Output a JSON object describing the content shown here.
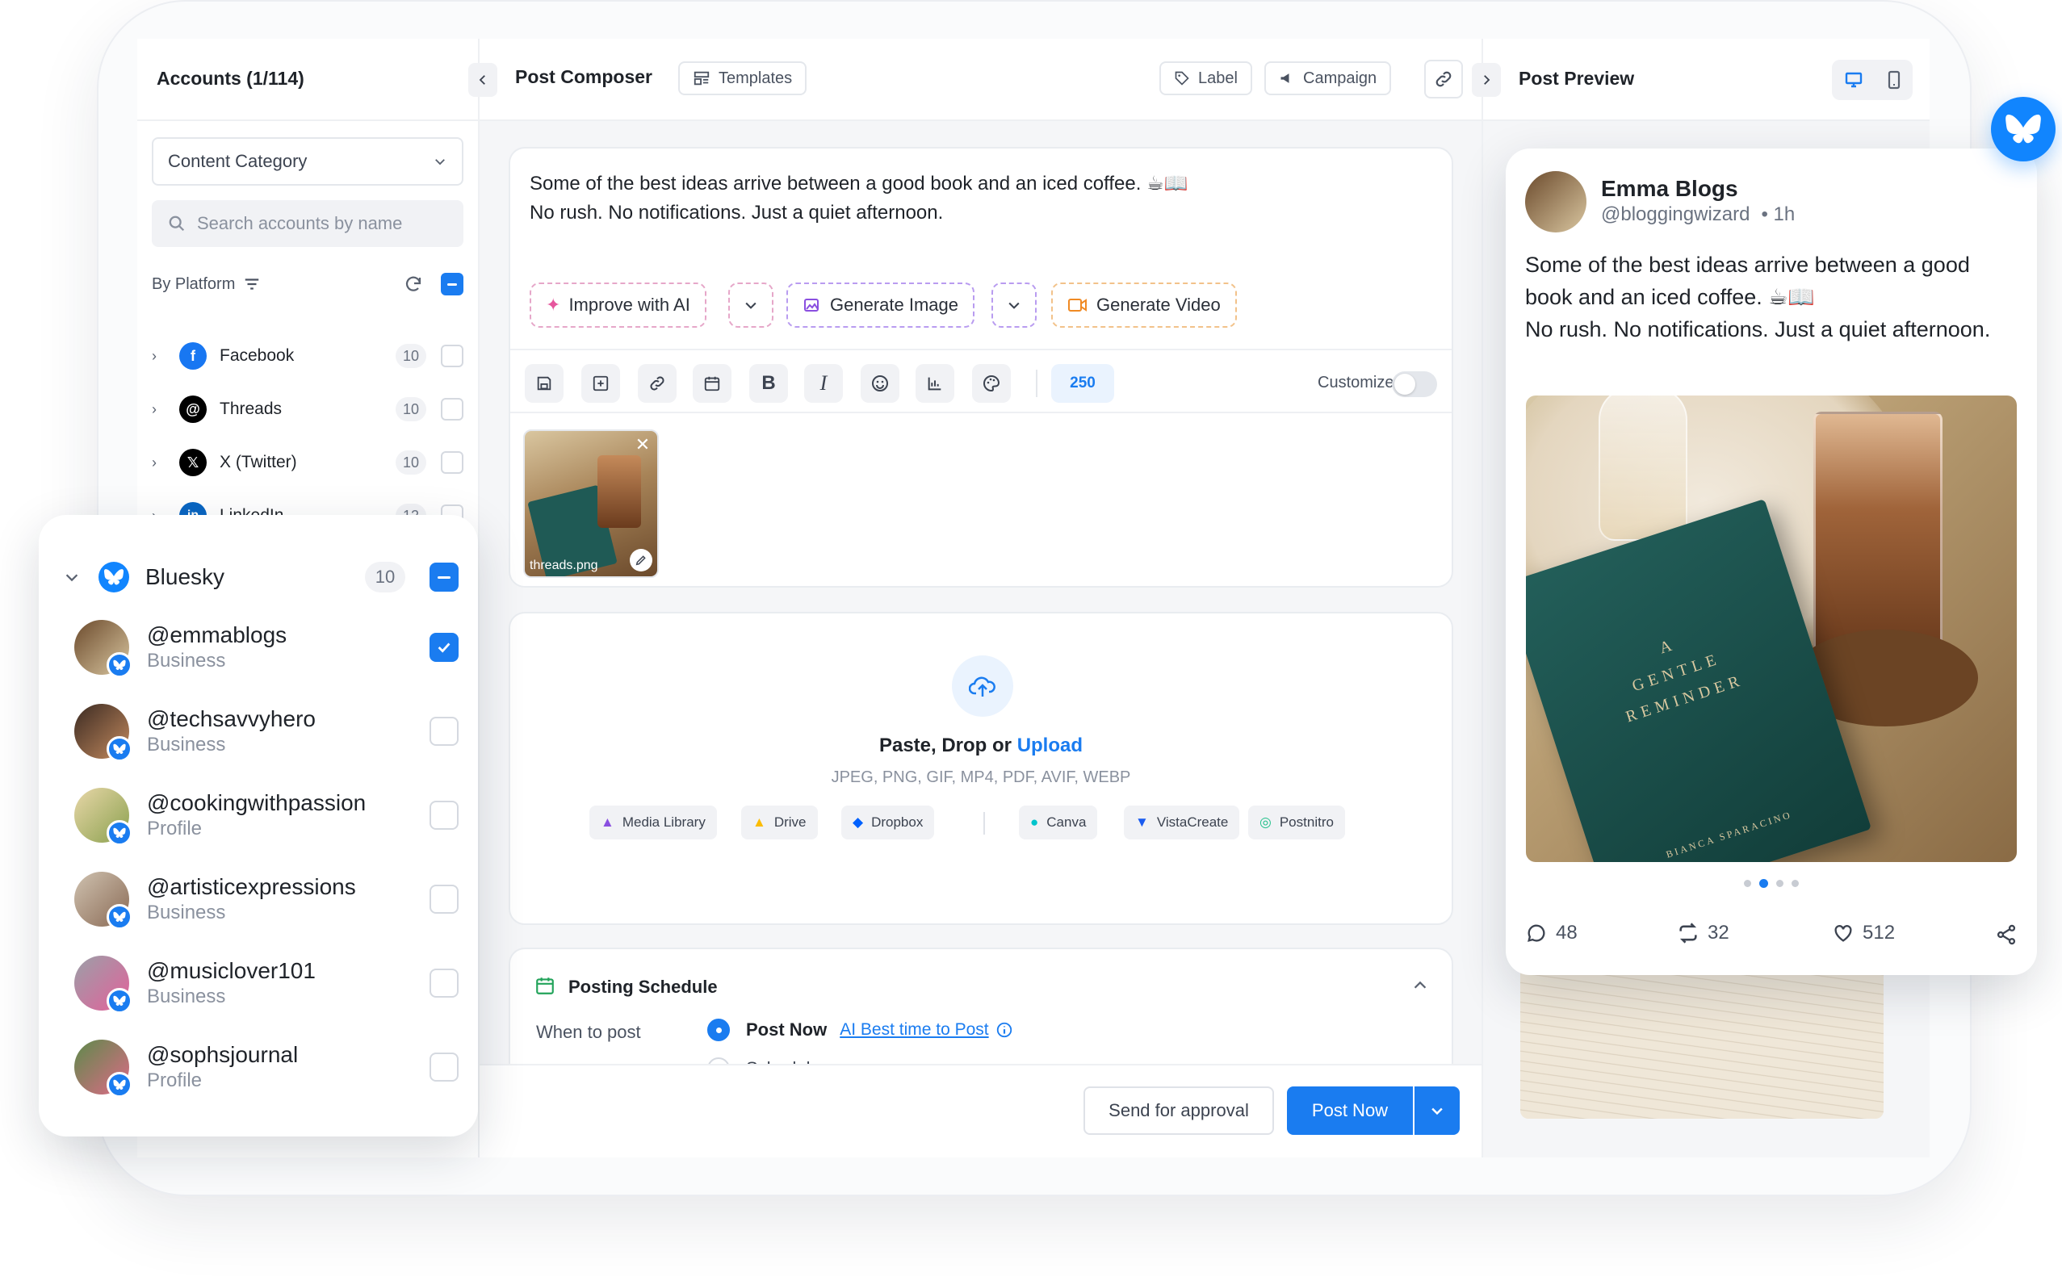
{
  "accounts": {
    "title": "Accounts (1/114)",
    "category_select": "Content Category",
    "search_placeholder": "Search accounts by name",
    "by_platform": "By Platform",
    "platforms": [
      {
        "name": "Facebook",
        "count": "10",
        "color": "#1877f2"
      },
      {
        "name": "Threads",
        "count": "10",
        "color": "#000000"
      },
      {
        "name": "X (Twitter)",
        "count": "10",
        "color": "#000000"
      },
      {
        "name": "LinkedIn",
        "count": "12",
        "color": "#0a66c2"
      }
    ]
  },
  "bluesky": {
    "name": "Bluesky",
    "count": "10",
    "users": [
      {
        "handle": "@emmablogs",
        "type": "Business",
        "checked": true
      },
      {
        "handle": "@techsavvyhero",
        "type": "Business",
        "checked": false
      },
      {
        "handle": "@cookingwithpassion",
        "type": "Profile",
        "checked": false
      },
      {
        "handle": "@artisticexpressions",
        "type": "Business",
        "checked": false
      },
      {
        "handle": "@musiclover101",
        "type": "Business",
        "checked": false
      },
      {
        "handle": "@sophsjournal",
        "type": "Profile",
        "checked": false
      }
    ]
  },
  "composer": {
    "title": "Post Composer",
    "templates": "Templates",
    "label": "Label",
    "campaign": "Campaign",
    "post_line1": "Some of the best ideas arrive between a good book and an iced coffee. ☕📖",
    "post_line2": "No rush. No notifications. Just a quiet afternoon.",
    "improve_ai": "Improve with AI",
    "generate_image": "Generate Image",
    "generate_video": "Generate Video",
    "char_count": "250",
    "customize": "Customize",
    "attachment_name": "threads.png",
    "upload_prefix": "Paste, Drop or ",
    "upload_link": "Upload",
    "formats": "JPEG, PNG, GIF, MP4, PDF, AVIF, WEBP",
    "sources": [
      "Media Library",
      "Drive",
      "Dropbox",
      "Canva",
      "VistaCreate",
      "Postnitro"
    ],
    "schedule_title": "Posting Schedule",
    "when_label": "When to post",
    "post_now_opt": "Post Now",
    "ai_best": "AI Best time to Post",
    "schedule_opt": "Schedule",
    "send_approval": "Send for approval",
    "post_now_btn": "Post Now"
  },
  "preview": {
    "title": "Post Preview",
    "author": "Emma Blogs",
    "handle": "@bloggingwizard",
    "time": "• 1h",
    "text_line1": "Some of the best ideas arrive between a good book and an iced coffee. ☕📖",
    "text_line2": "No rush. No notifications. Just a quiet afternoon.",
    "book_title_1": "A",
    "book_title_2": "GENTLE",
    "book_title_3": "REMINDER",
    "book_author": "BIANCA SPARACINO",
    "comments": "48",
    "reposts": "32",
    "likes": "512"
  },
  "colors": {
    "accent": "#1a7cf0",
    "bluesky": "#1185fe"
  }
}
